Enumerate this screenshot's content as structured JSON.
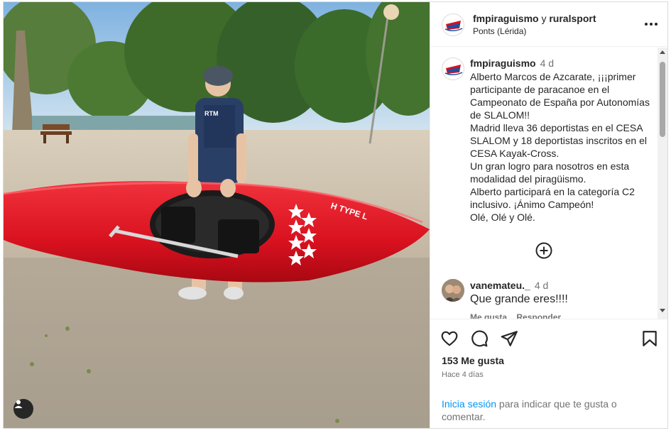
{
  "header": {
    "author": "fmpiraguismo",
    "connector": "y",
    "collaborator": "ruralsport",
    "location": "Ponts (Lérida)",
    "more_icon": "more-horizontal-icon"
  },
  "caption": {
    "username": "fmpiraguismo",
    "time": "4 d",
    "lines": [
      "Alberto Marcos de Azcarate, ¡¡¡primer participante de paracanoe en el Campeonato de España por Autonomías de SLALOM!!",
      "Madrid lleva 36 deportistas en el CESA SLALOM y 18 deportistas inscritos en el CESA Kayak-Cross.",
      "Un gran logro para nosotros en esta modalidad del piragüismo.",
      "Alberto participará en la categoría C2 inclusivo. ¡Ánimo Campeón!",
      "Olé, Olé y Olé."
    ]
  },
  "load_more_icon": "plus-circle-icon",
  "comment": {
    "username": "vanemateu._",
    "time": "4 d",
    "text": "Que grande eres!!!!",
    "like_label": "Me gusta",
    "reply_label": "Responder"
  },
  "actions": {
    "icons": [
      "heart-icon",
      "comment-icon",
      "share-icon",
      "bookmark-icon"
    ],
    "likes": "153 Me gusta",
    "date": "Hace 4 días"
  },
  "login": {
    "link": "Inicia sesión",
    "rest": " para indicar que te gusta o comentar."
  },
  "photo": {
    "kayak_text": "RTM",
    "tag_icon": "user-tag-icon"
  }
}
